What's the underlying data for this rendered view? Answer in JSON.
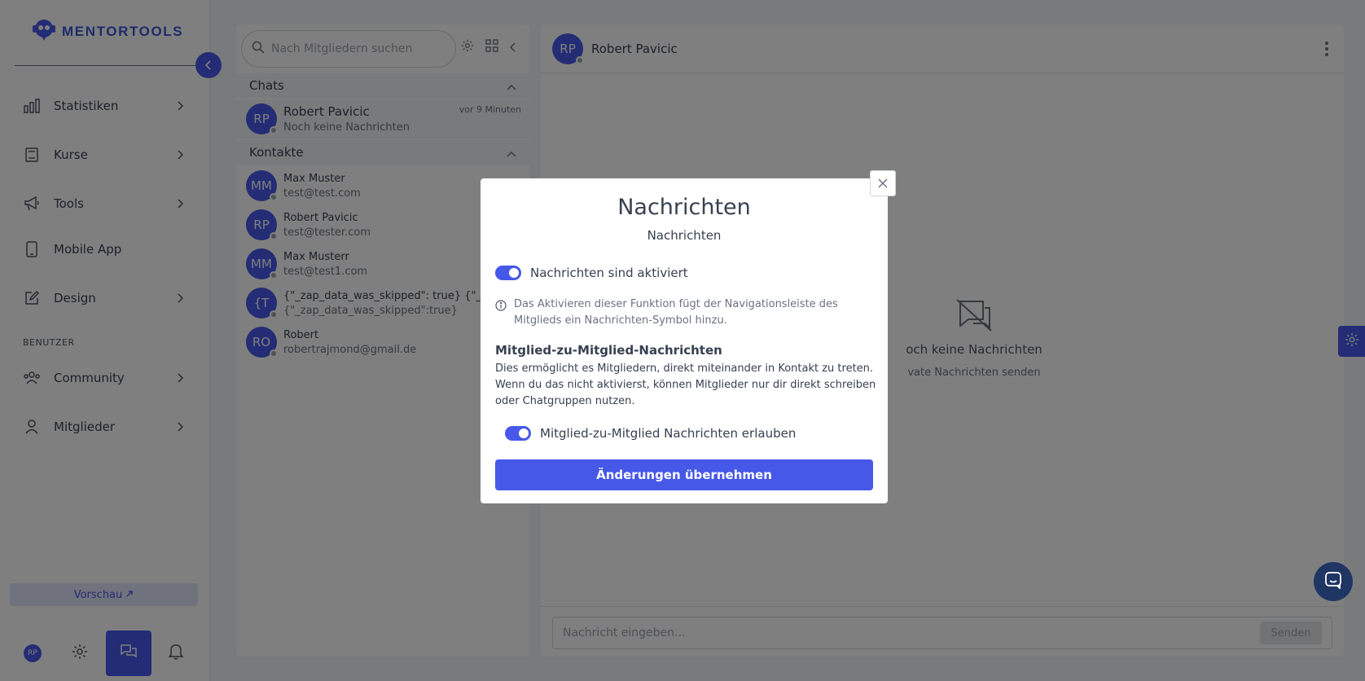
{
  "colors": {
    "accent": "#4658e8",
    "overlay": "rgba(0,0,0,0.5)",
    "offline_dot": "#9ca3af"
  },
  "sidebar": {
    "logo_text": "MENTORTOOLS",
    "nav": [
      {
        "label": "Statistiken",
        "icon": "bar-chart-icon"
      },
      {
        "label": "Kurse",
        "icon": "book-icon"
      },
      {
        "label": "Tools",
        "icon": "megaphone-icon"
      },
      {
        "label": "Mobile App",
        "icon": "mobile-icon"
      },
      {
        "label": "Design",
        "icon": "pencil-icon"
      }
    ],
    "section_label": "BENUTZER",
    "nav2": [
      {
        "label": "Community",
        "icon": "community-icon"
      },
      {
        "label": "Mitglieder",
        "icon": "user-icon"
      }
    ],
    "preview_label": "Vorschau",
    "user_initials": "RP"
  },
  "chatlist": {
    "search_placeholder": "Nach Mitgliedern suchen",
    "chats_label": "Chats",
    "chats": [
      {
        "initials": "RP",
        "name": "Robert Pavicic",
        "sub": "Noch keine Nachrichten",
        "time": "vor 9 Minuten"
      }
    ],
    "contacts_label": "Kontakte",
    "contacts": [
      {
        "initials": "MM",
        "name": "Max Muster",
        "sub": "test@test.com"
      },
      {
        "initials": "RP",
        "name": "Robert Pavicic",
        "sub": "test@tester.com"
      },
      {
        "initials": "MM",
        "name": "Max Musterr",
        "sub": "test@test1.com"
      },
      {
        "initials": "{T",
        "name": "{\"_zap_data_was_skipped\": true} {\"_zap_",
        "sub": "{\"_zap_data_was_skipped\":true}"
      },
      {
        "initials": "RO",
        "name": "Robert",
        "sub": "robertrajmond@gmail.de"
      }
    ]
  },
  "conversation": {
    "initials": "RP",
    "name": "Robert Pavicic",
    "empty_title": "och keine Nachrichten",
    "empty_sub": "vate Nachrichten senden",
    "input_placeholder": "Nachricht eingeben...",
    "send_label": "Senden"
  },
  "modal": {
    "title": "Nachrichten",
    "subtitle": "Nachrichten",
    "toggle1_label": "Nachrichten sind aktiviert",
    "toggle1_on": true,
    "info_text": "Das Aktivieren dieser Funktion fügt der Navigationsleiste des Mitglieds ein Nachrichten-Symbol hinzu.",
    "section_title": "Mitglied-zu-Mitglied-Nachrichten",
    "section_desc": "Dies ermöglicht es Mitgliedern, direkt miteinander in Kontakt zu treten. Wenn du das nicht aktivierst, können Mitglieder nur dir direkt schreiben oder Chatgruppen nutzen.",
    "toggle2_label": "Mitglied-zu-Mitglied Nachrichten erlauben",
    "toggle2_on": true,
    "apply_label": "Änderungen übernehmen"
  }
}
